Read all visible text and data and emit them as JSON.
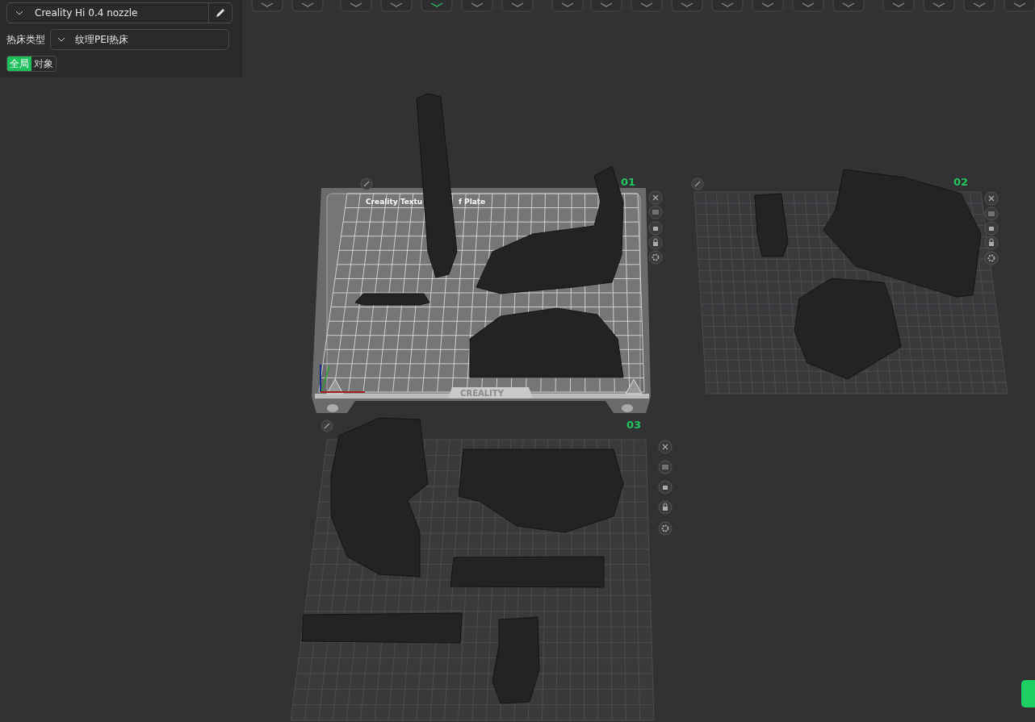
{
  "printer_select": {
    "value": "Creality Hi 0.4 nozzle"
  },
  "bed_type": {
    "label": "热床类型",
    "value": "纹理PEI热床"
  },
  "scope_tabs": [
    {
      "label": "全局",
      "selected": true
    },
    {
      "label": "对象",
      "selected": false
    }
  ],
  "plates": [
    {
      "number": "01",
      "kind": "textured",
      "bed_label_parts": [
        "Creality Textu",
        "f Plate"
      ],
      "logo": "CREALITY"
    },
    {
      "number": "02",
      "kind": "grid"
    },
    {
      "number": "03",
      "kind": "grid"
    }
  ]
}
